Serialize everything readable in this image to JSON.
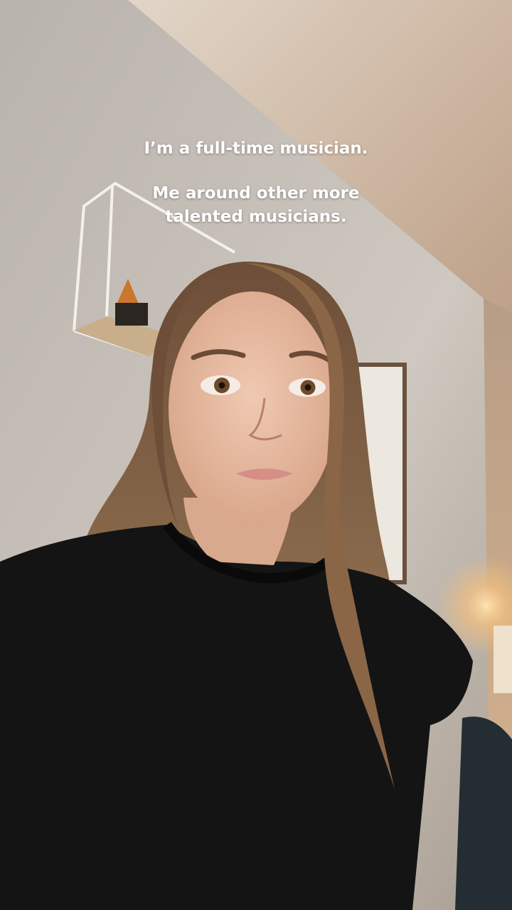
{
  "caption": {
    "line1": "I’m a full-time musician.",
    "line2": "Me around other more",
    "line3": "talented musicians."
  },
  "palette": {
    "wall": "#c9c3bc",
    "ceiling": "#d8c6b2",
    "hair": "#7a5a42",
    "shirt": "#121212",
    "skin": "#e2b49c",
    "lamp_glow": "#f6c98a"
  }
}
